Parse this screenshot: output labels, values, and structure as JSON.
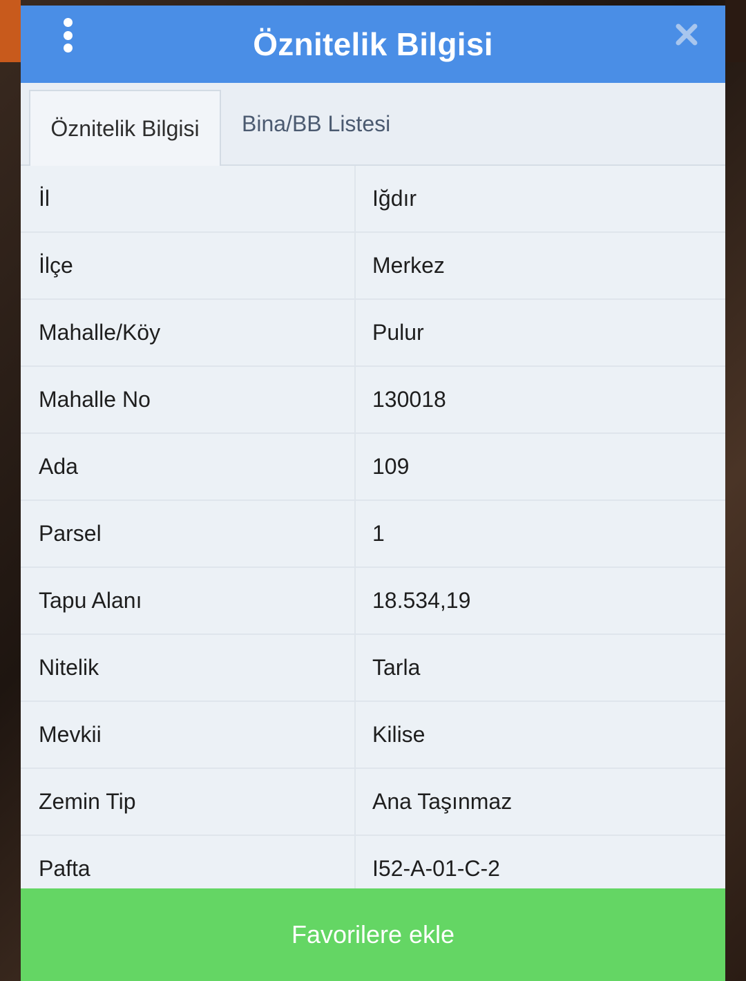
{
  "dialog": {
    "title": "Öznitelik Bilgisi",
    "header_color": "#4a8ee6",
    "menu_icon": "vertical-dots-icon",
    "close_icon": "close-x-icon"
  },
  "tabs": [
    {
      "label": "Öznitelik Bilgisi",
      "active": true
    },
    {
      "label": "Bina/BB Listesi",
      "active": false
    }
  ],
  "attributes": [
    {
      "label": "İl",
      "value": "Iğdır"
    },
    {
      "label": "İlçe",
      "value": "Merkez"
    },
    {
      "label": "Mahalle/Köy",
      "value": "Pulur"
    },
    {
      "label": "Mahalle No",
      "value": "130018"
    },
    {
      "label": "Ada",
      "value": "109"
    },
    {
      "label": "Parsel",
      "value": "1"
    },
    {
      "label": "Tapu Alanı",
      "value": "18.534,19"
    },
    {
      "label": "Nitelik",
      "value": "Tarla"
    },
    {
      "label": "Mevkii",
      "value": "Kilise"
    },
    {
      "label": "Zemin Tip",
      "value": "Ana Taşınmaz"
    },
    {
      "label": "Pafta",
      "value": "I52-A-01-C-2"
    }
  ],
  "footer": {
    "favorite_label": "Favorilere ekle",
    "button_color": "#64d664"
  }
}
